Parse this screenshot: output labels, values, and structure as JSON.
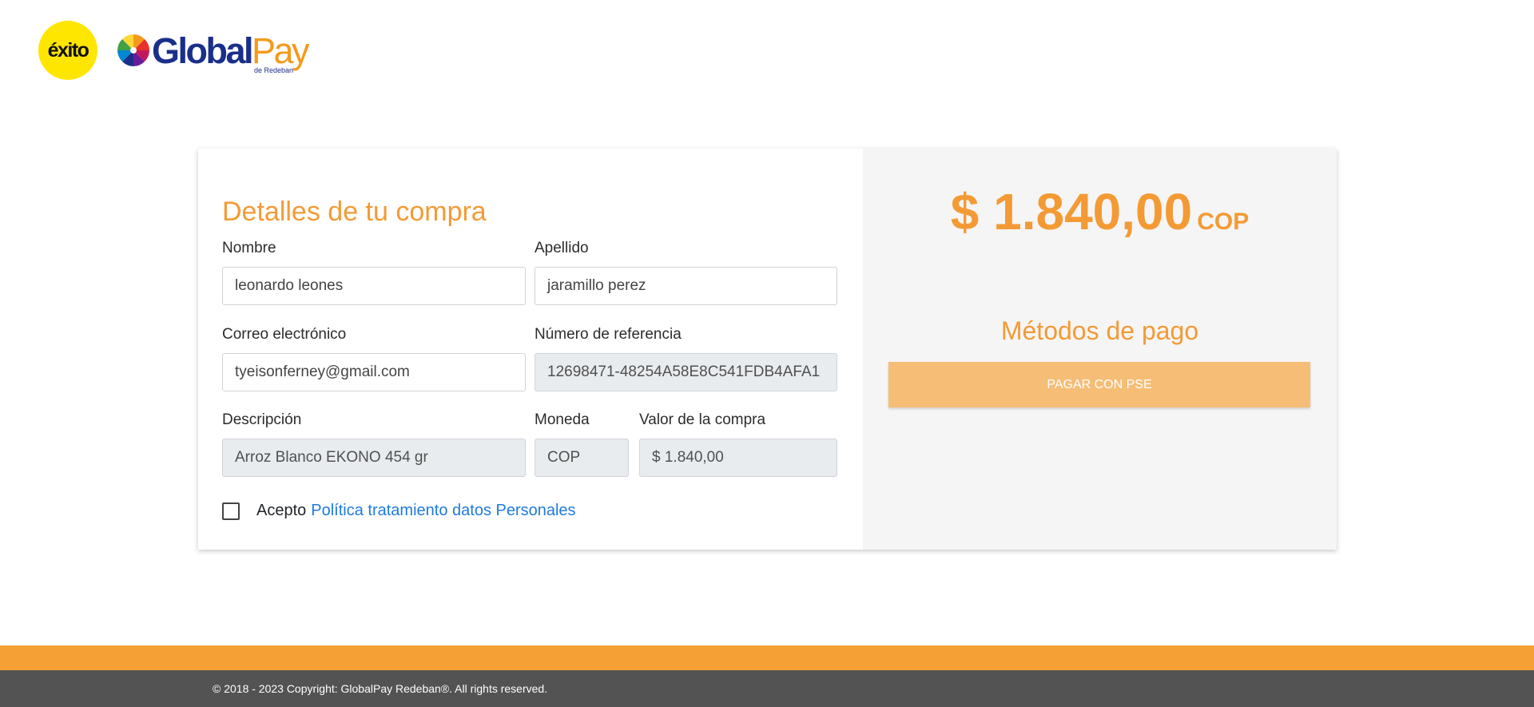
{
  "logos": {
    "exito_text": "éxito",
    "globalpay_main": "Global",
    "globalpay_accent": "Pay",
    "globalpay_sub": "de Redeban"
  },
  "form": {
    "title": "Detalles de tu compra",
    "nombre": {
      "label": "Nombre",
      "value": "leonardo leones"
    },
    "apellido": {
      "label": "Apellido",
      "value": "jaramillo perez"
    },
    "correo": {
      "label": "Correo electrónico",
      "value": "tyeisonferney@gmail.com"
    },
    "referencia": {
      "label": "Número de referencia",
      "value": "12698471-48254A58E8C541FDB4AFA1"
    },
    "descripcion": {
      "label": "Descripción",
      "value": "Arroz Blanco EKONO 454 gr"
    },
    "moneda": {
      "label": "Moneda",
      "value": "COP"
    },
    "valor": {
      "label": "Valor de la compra",
      "value": "$ 1.840,00"
    },
    "consent": {
      "prefix": "Acepto",
      "link": "Política tratamiento datos Personales",
      "checked": false
    }
  },
  "summary": {
    "amount": "$ 1.840,00",
    "currency": "COP",
    "methods_title": "Métodos de pago",
    "pse_button": "PAGAR CON PSE"
  },
  "footer": {
    "copyright": "© 2018 - 2023 Copyright: GlobalPay Redeban®. All rights reserved."
  },
  "colors": {
    "accent": "#f49a35",
    "button": "#f5bd75",
    "link": "#1f7ae0",
    "footer_band": "#f5a035",
    "footer": "#535353"
  }
}
